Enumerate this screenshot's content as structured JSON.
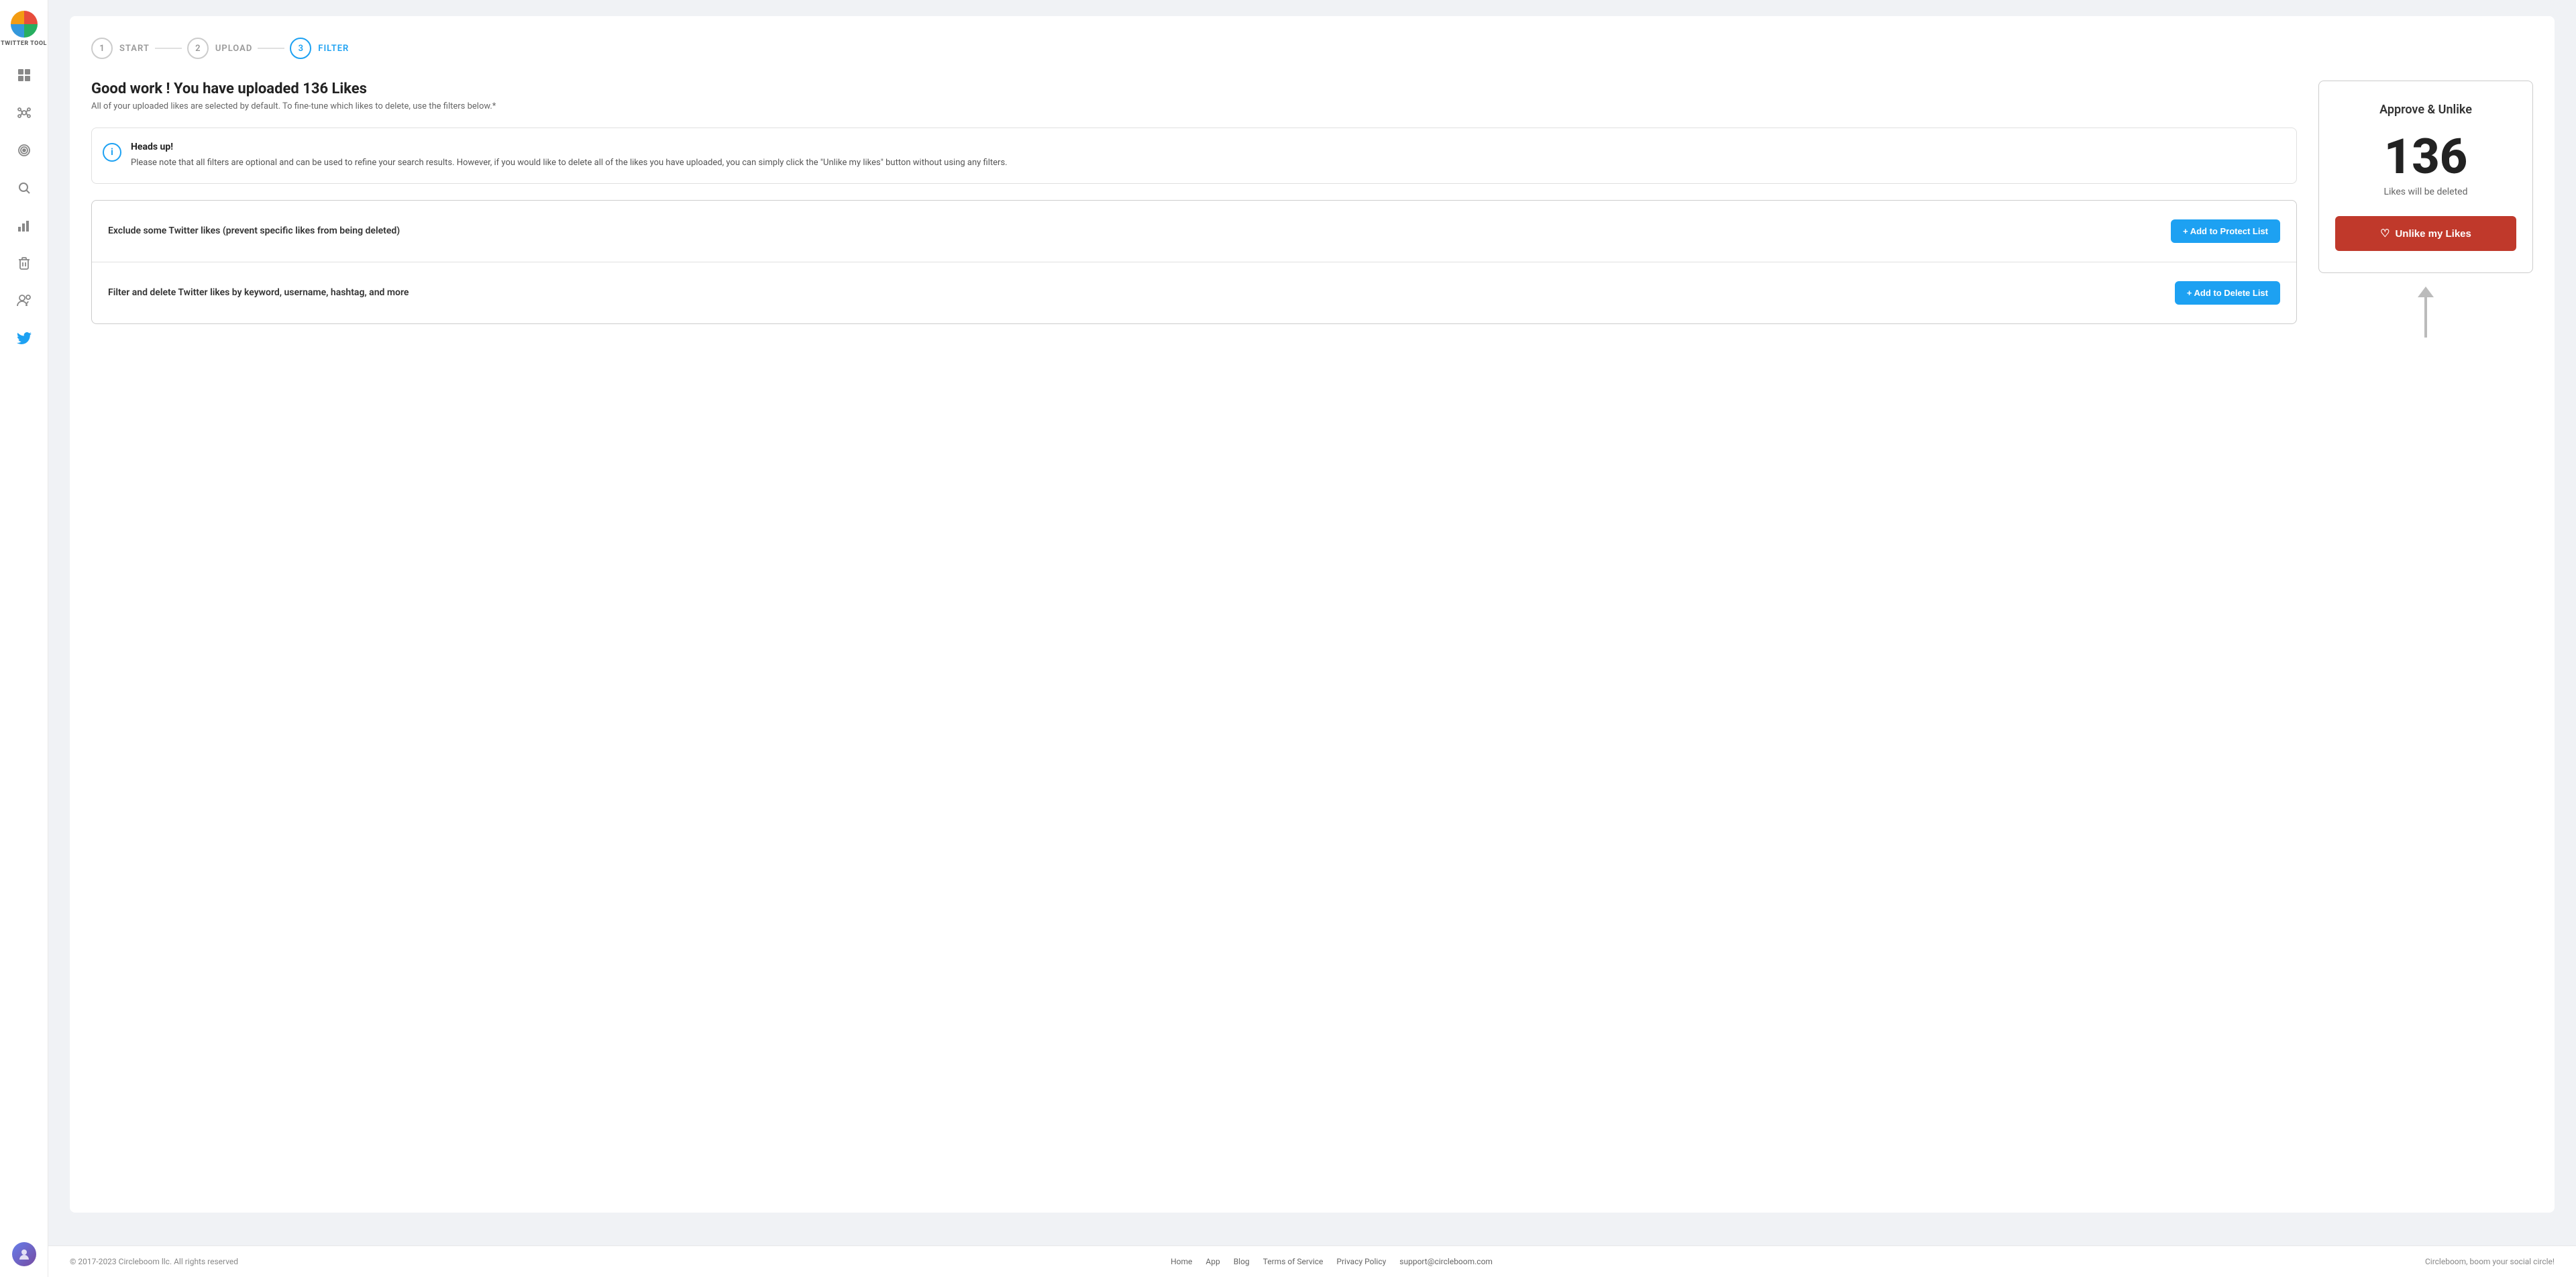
{
  "sidebar": {
    "logo_text": "TWITTER TOOL",
    "icons": [
      {
        "name": "dashboard-icon",
        "symbol": "⊞",
        "active": false
      },
      {
        "name": "network-icon",
        "symbol": "⬡",
        "active": false
      },
      {
        "name": "target-icon",
        "symbol": "◎",
        "active": false
      },
      {
        "name": "search-icon",
        "symbol": "⌕",
        "active": false
      },
      {
        "name": "analytics-icon",
        "symbol": "▮",
        "active": false
      },
      {
        "name": "delete-icon",
        "symbol": "🗑",
        "active": false
      },
      {
        "name": "users-icon",
        "symbol": "👥",
        "active": false
      },
      {
        "name": "twitter-icon",
        "symbol": "🐦",
        "active": true
      }
    ]
  },
  "stepper": {
    "steps": [
      {
        "number": "1",
        "label": "START",
        "active": false
      },
      {
        "number": "2",
        "label": "UPLOAD",
        "active": false
      },
      {
        "number": "3",
        "label": "FILTER",
        "active": true
      }
    ]
  },
  "main": {
    "title": "Good work ! You have uploaded 136 Likes",
    "subtitle": "All of your uploaded likes are selected by default. To fine-tune which likes to delete, use the filters below.*",
    "info_box": {
      "title": "Heads up!",
      "text": "Please note that all filters are optional and can be used to refine your search results. However, if you would like to delete all of the likes you have uploaded, you can simply click the \"Unlike my likes\" button without using any filters."
    },
    "filters": [
      {
        "label": "Exclude some Twitter likes (prevent specific likes from being deleted)",
        "button": "+ Add to Protect List"
      },
      {
        "label": "Filter and delete Twitter likes by keyword, username, hashtag, and more",
        "button": "+ Add to Delete List"
      }
    ]
  },
  "approve_panel": {
    "title": "Approve & Unlike",
    "count": "136",
    "subtitle": "Likes will be deleted",
    "button_label": "Unlike my Likes"
  },
  "footer": {
    "copyright": "© 2017-2023 Circleboom llc. All rights reserved",
    "links": [
      "Home",
      "App",
      "Blog",
      "Terms of Service",
      "Privacy Policy",
      "support@circleboom.com"
    ],
    "tagline": "Circleboom, boom your social circle!"
  }
}
